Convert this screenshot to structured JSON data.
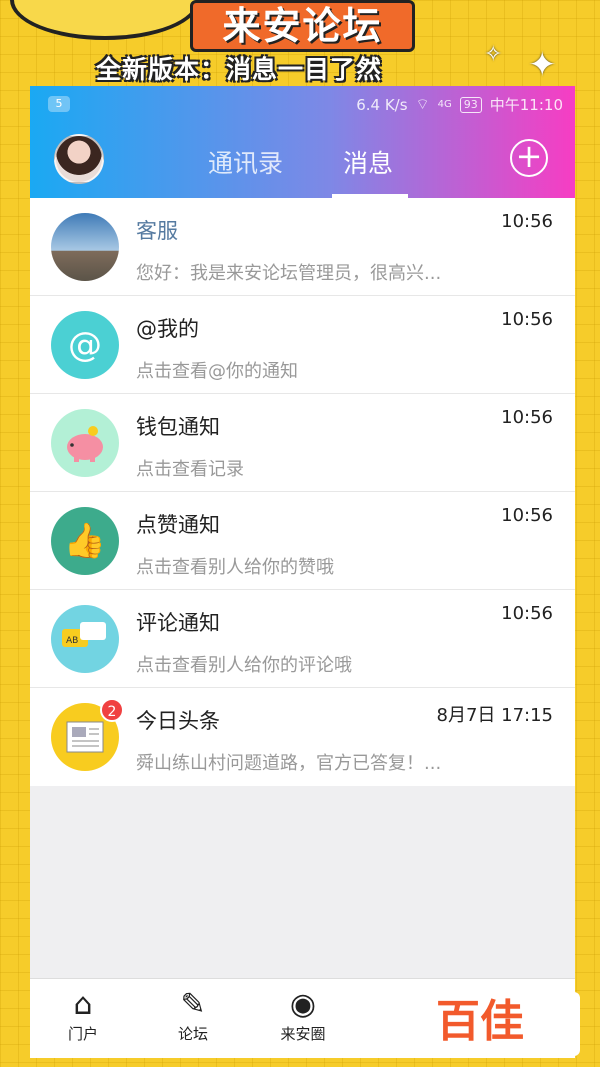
{
  "promo": {
    "title": "来安论坛",
    "subtitle": "全新版本：消息一目了然"
  },
  "status_bar": {
    "badge": "5",
    "speed": "6.4 K/s",
    "network": "4G",
    "battery": "93",
    "time": "中午11:10"
  },
  "header": {
    "tab_contacts": "通讯录",
    "tab_messages": "消息",
    "plus": "+"
  },
  "messages": [
    {
      "title": "客服",
      "time": "10:56",
      "preview": "您好：我是来安论坛管理员，很高兴...",
      "icon": "sky-avatar-icon"
    },
    {
      "title": "@我的",
      "time": "10:56",
      "preview": "点击查看@你的通知",
      "icon": "at-icon",
      "color": "#4bd0d3"
    },
    {
      "title": "钱包通知",
      "time": "10:56",
      "preview": "点击查看记录",
      "icon": "piggy-bank-icon",
      "color": "#8ee8c7"
    },
    {
      "title": "点赞通知",
      "time": "10:56",
      "preview": "点击查看别人给你的赞哦",
      "icon": "thumbs-up-icon",
      "color": "#3dab8c"
    },
    {
      "title": "评论通知",
      "time": "10:56",
      "preview": "点击查看别人给你的评论哦",
      "icon": "comment-bubbles-icon",
      "color": "#72d4e2"
    },
    {
      "title": "今日头条",
      "time": "8月7日 17:15",
      "preview": "舜山练山村问题道路，官方已答复！...",
      "icon": "newspaper-icon",
      "color": "#f8cc1f",
      "badge": "2"
    }
  ],
  "bottom_nav": [
    {
      "label": "门户",
      "icon": "home-icon"
    },
    {
      "label": "论坛",
      "icon": "forum-icon"
    },
    {
      "label": "来安圈",
      "icon": "aperture-icon"
    }
  ],
  "watermark": "百佳"
}
